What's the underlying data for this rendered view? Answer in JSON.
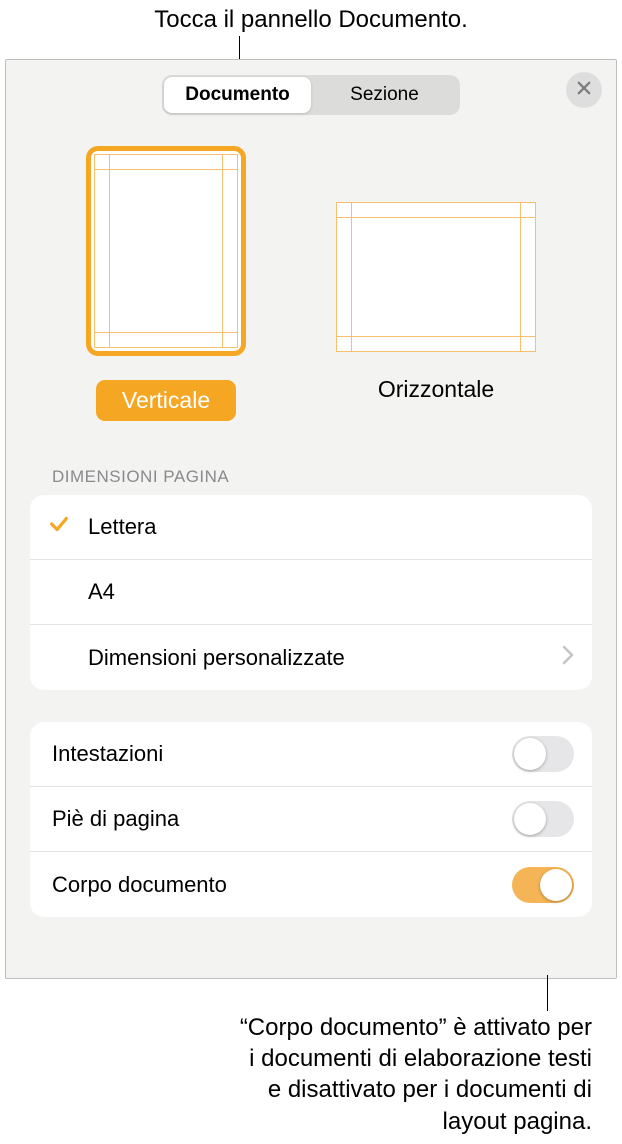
{
  "callouts": {
    "top": "Tocca il pannello Documento.",
    "bottom_l1": "“Corpo documento” è attivato per",
    "bottom_l2": "i documenti di elaborazione testi",
    "bottom_l3": "e disattivato per i documenti di",
    "bottom_l4": "layout pagina."
  },
  "tabs": {
    "documento": "Documento",
    "sezione": "Sezione"
  },
  "orientation": {
    "portrait": "Verticale",
    "landscape": "Orizzontale",
    "selected": "portrait"
  },
  "page_size": {
    "title": "DIMENSIONI PAGINA",
    "options": {
      "letter": "Lettera",
      "a4": "A4",
      "custom": "Dimensioni personalizzate"
    },
    "selected": "letter"
  },
  "settings": {
    "headers": {
      "label": "Intestazioni",
      "value": false
    },
    "footers": {
      "label": "Piè di pagina",
      "value": false
    },
    "body": {
      "label": "Corpo documento",
      "value": true
    }
  }
}
